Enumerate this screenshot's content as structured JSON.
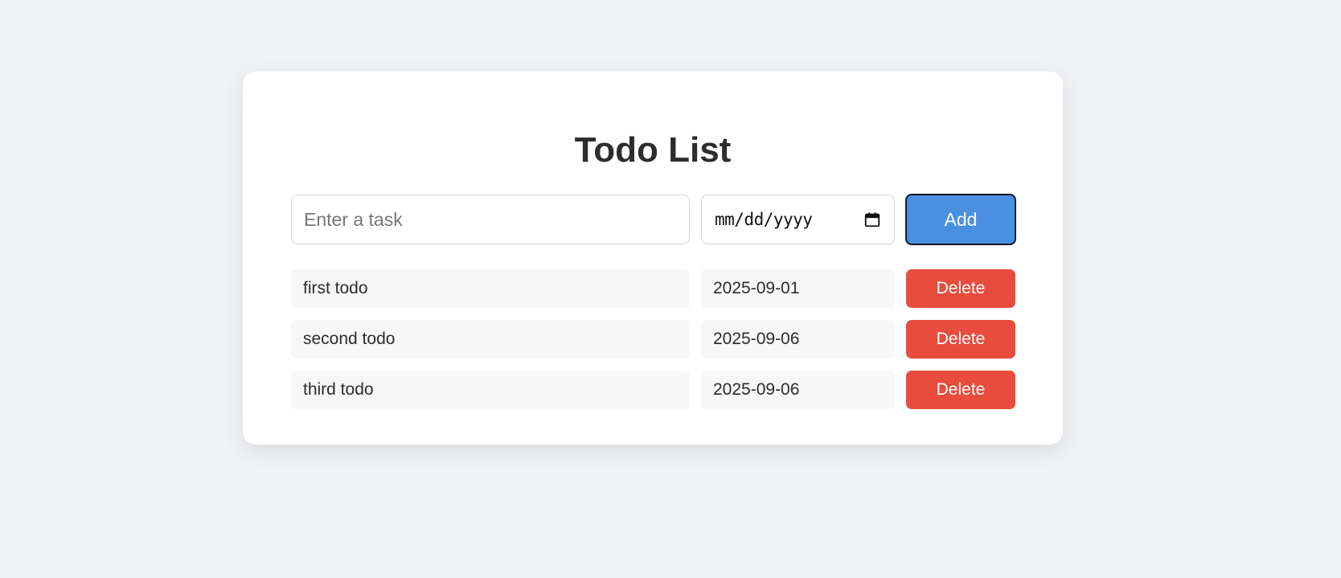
{
  "app": {
    "title": "Todo List"
  },
  "form": {
    "task_placeholder": "Enter a task",
    "task_value": "",
    "date_placeholder": "mm/dd/yyyy",
    "date_value": "",
    "add_label": "Add",
    "calendar_icon": "calendar-icon"
  },
  "todos": [
    {
      "text": "first todo",
      "date": "2025-09-01",
      "delete_label": "Delete"
    },
    {
      "text": "second todo",
      "date": "2025-09-06",
      "delete_label": "Delete"
    },
    {
      "text": "third todo",
      "date": "2025-09-06",
      "delete_label": "Delete"
    }
  ],
  "colors": {
    "background": "#f0f2f5",
    "card": "#ffffff",
    "add_button": "#4a90e2",
    "delete_button": "#e74c3c",
    "row_background": "#f7f7f8",
    "title_text": "#2d2d2d"
  }
}
